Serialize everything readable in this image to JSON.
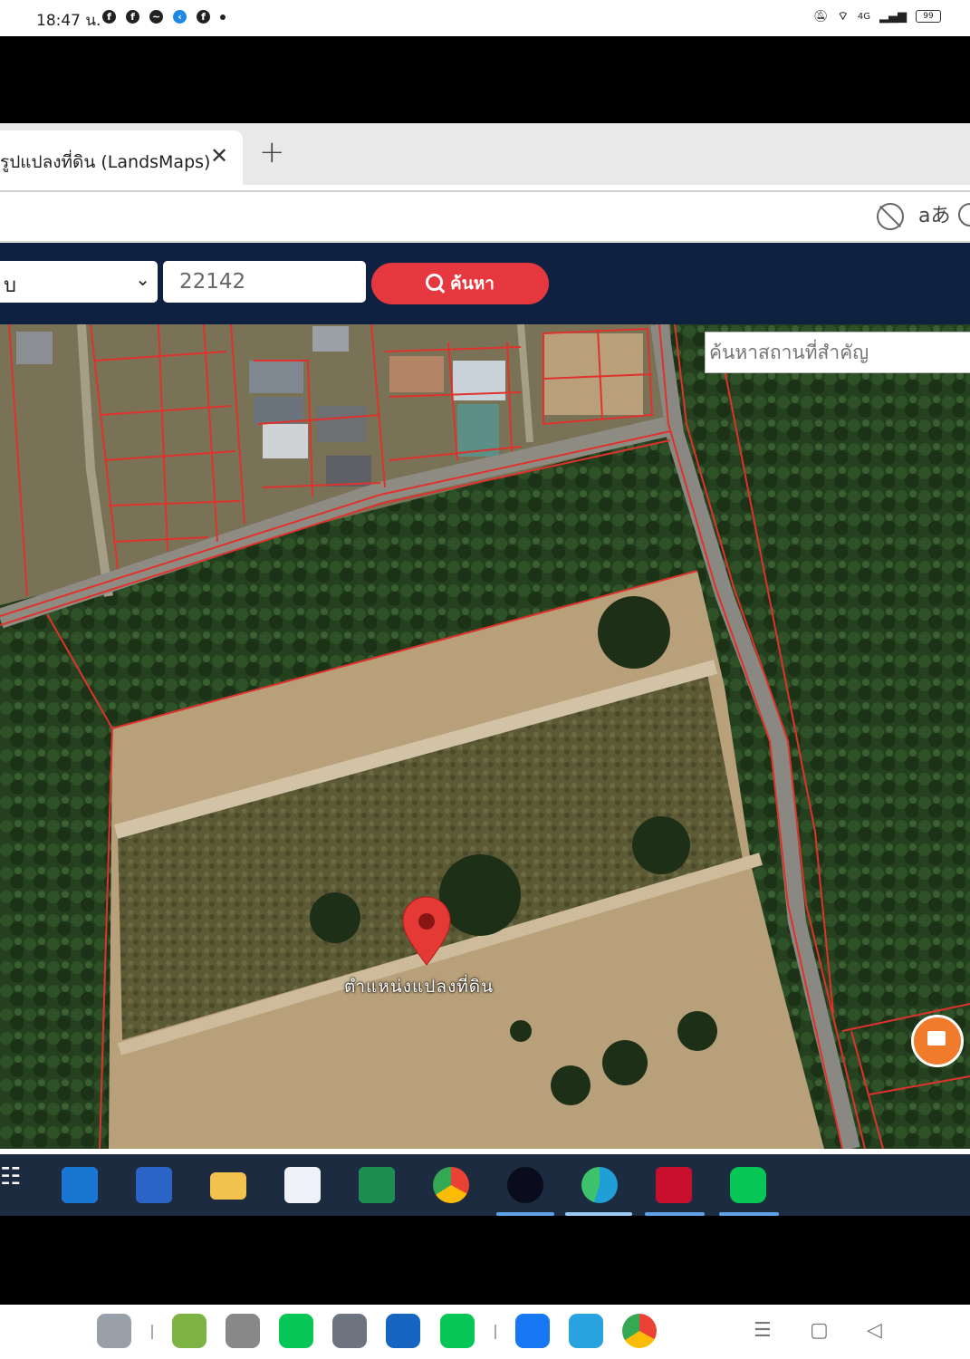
{
  "status_bar": {
    "time": "18:47 น.",
    "battery": "99",
    "left_icons": [
      "facebook-icon",
      "facebook-icon",
      "messenger-icon",
      "app-icon",
      "facebook-icon",
      "dot-icon"
    ],
    "right_icons": [
      "mute-icon",
      "wifi-icon",
      "volte-icon",
      "signal-icon",
      "battery-icon"
    ]
  },
  "browser": {
    "tab_title": "รูปแปลงที่ดิน (LandsMaps)",
    "tab_close": "✕",
    "new_tab": "+",
    "translate_label": "aあ"
  },
  "site": {
    "select_value": "บ",
    "parcel_input_value": "22142",
    "search_button_label": "ค้นหา",
    "accent_color": "#e5393f",
    "header_color": "#0f2140"
  },
  "map": {
    "place_search_placeholder": "ค้นหาสถานที่สำคัญ",
    "marker_label": "ตำแหน่งแปลงที่ดิน",
    "marker_color": "#e53935",
    "boundary_color": "#e0322c"
  },
  "taskbar": {
    "apps": [
      "widgets-icon",
      "outlook-icon",
      "word-icon",
      "file-explorer-icon",
      "microsoft-store-icon",
      "excel-icon",
      "chrome-icon",
      "webex-icon",
      "edge-icon",
      "mcafee-icon",
      "line-icon"
    ]
  },
  "dock": {
    "apps": [
      "app-drawer-icon",
      "lands-dept-icon",
      "camera-icon",
      "line-icon",
      "settings-icon",
      "app-icon",
      "line-icon",
      "facebook-icon",
      "maps-icon",
      "chrome-icon"
    ],
    "nav": [
      "recents-nav",
      "home-nav",
      "back-nav"
    ],
    "nav_glyphs": [
      "☰",
      "▢",
      "◁"
    ]
  }
}
